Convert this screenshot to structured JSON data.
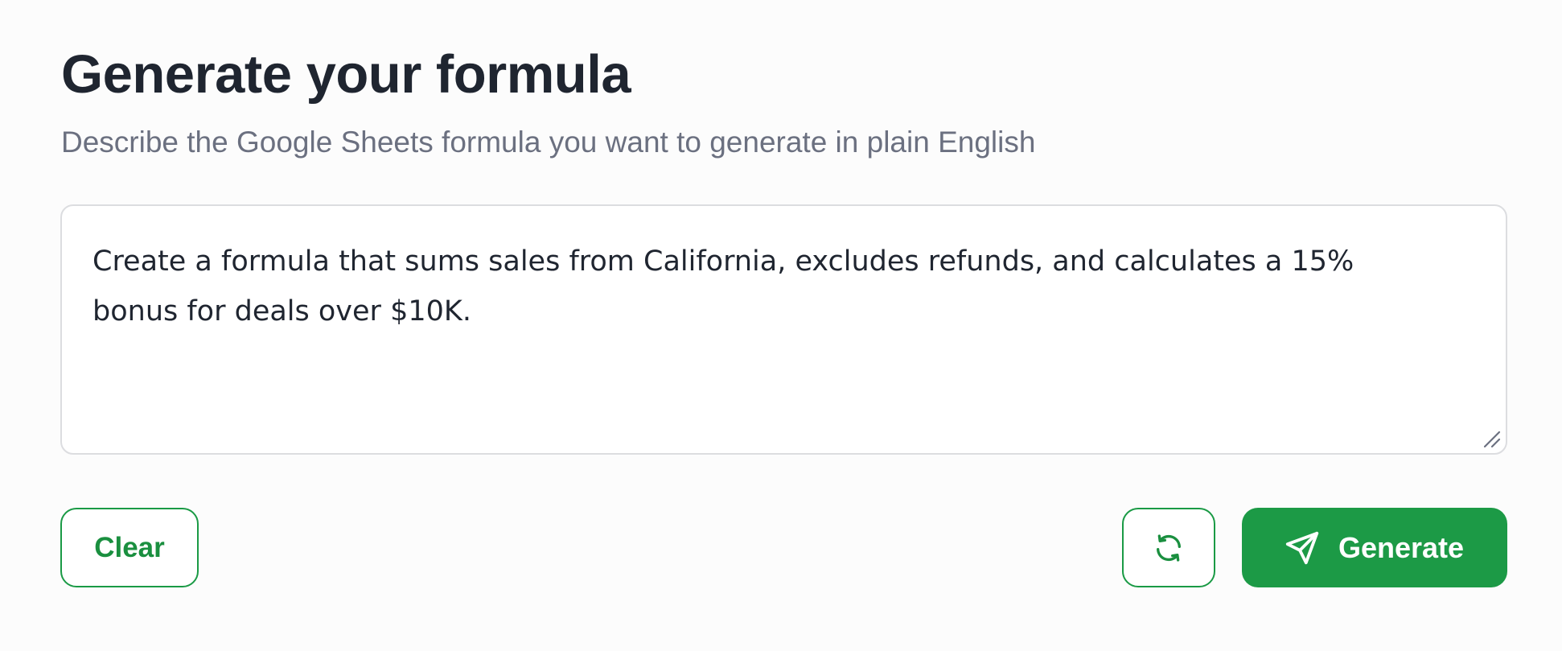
{
  "header": {
    "title": "Generate your formula",
    "subtitle": "Describe the Google Sheets formula you want to generate in plain English"
  },
  "prompt": {
    "value": "Create a formula that sums sales from California, excludes refunds, and calculates a 15% bonus for deals over $10K."
  },
  "actions": {
    "clear_label": "Clear",
    "refresh_icon": "refresh-icon",
    "generate_label": "Generate",
    "generate_icon": "send-icon"
  },
  "colors": {
    "accent": "#1c9a46",
    "title": "#1f2530",
    "subtitle": "#6b7080",
    "border": "#dcdde0",
    "background": "#fcfcfc"
  }
}
